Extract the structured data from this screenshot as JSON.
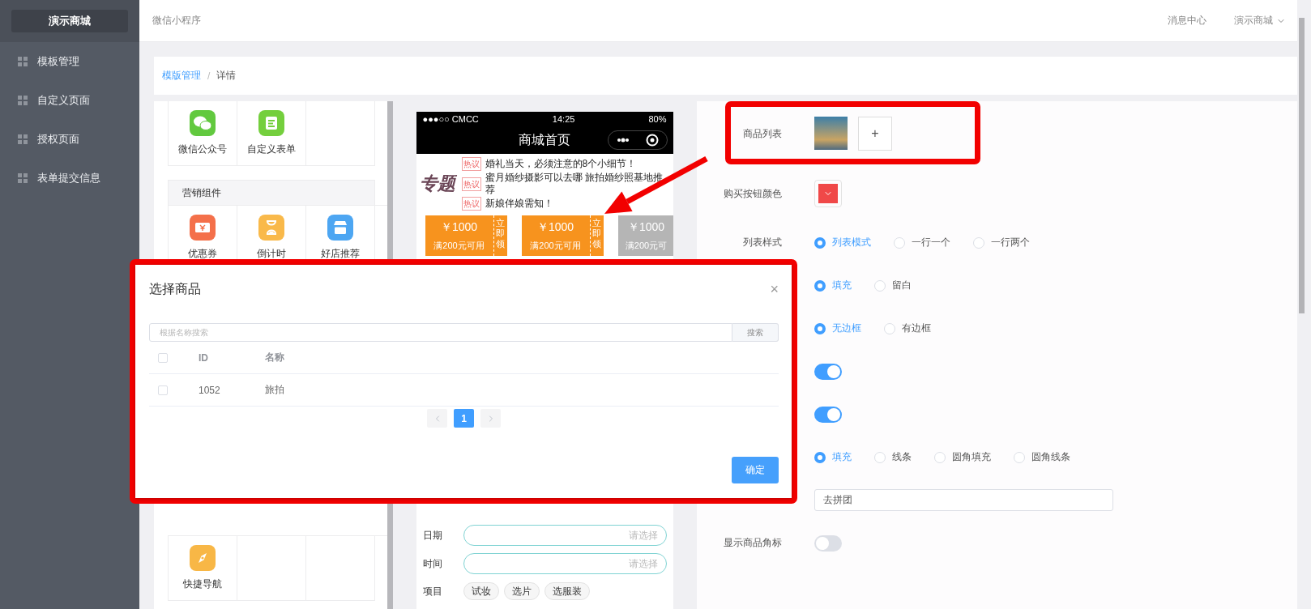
{
  "sidebar": {
    "brand": "演示商城",
    "items": [
      {
        "label": "模板管理"
      },
      {
        "label": "自定义页面"
      },
      {
        "label": "授权页面"
      },
      {
        "label": "表单提交信息"
      }
    ]
  },
  "header": {
    "title": "微信小程序",
    "link": "消息中心",
    "account": "演示商城"
  },
  "breadcrumb": {
    "items": [
      "模版管理",
      "详情"
    ],
    "separator": "/"
  },
  "components": {
    "top": [
      {
        "label": "微信公众号",
        "kind": "chat"
      },
      {
        "label": "自定义表单",
        "kind": "form"
      }
    ],
    "marketing": {
      "title": "营销组件",
      "items": [
        {
          "label": "优惠券",
          "kind": "ticket"
        },
        {
          "label": "倒计时",
          "kind": "hourglass"
        },
        {
          "label": "好店推荐",
          "kind": "shop"
        }
      ]
    },
    "bottom": [
      {
        "label": "快捷导航",
        "kind": "compass"
      }
    ]
  },
  "phone": {
    "status": {
      "carrier": "●●●○○ CMCC",
      "time": "14:25",
      "battery": "80%"
    },
    "title": "商城首页",
    "topic": {
      "badge": "专题",
      "items": [
        {
          "tag": "热议",
          "text": "婚礼当天，必须注意的8个小细节！"
        },
        {
          "tag": "热议",
          "text": "蜜月婚纱摄影可以去哪 旅拍婚纱照基地推荐"
        },
        {
          "tag": "热议",
          "text": "新娘伴娘需知！"
        }
      ]
    },
    "coupons": [
      {
        "amount": "￥1000",
        "condition": "满200元可用",
        "action": "立即领",
        "available": true
      },
      {
        "amount": "￥1000",
        "condition": "满200元可用",
        "action": "立即领",
        "available": true
      },
      {
        "amount": "￥1000",
        "condition": "满200元可",
        "available": false
      }
    ],
    "form": [
      {
        "kind": "field",
        "label": "日期",
        "placeholder": "请选择"
      },
      {
        "kind": "field",
        "label": "时间",
        "placeholder": "请选择"
      },
      {
        "kind": "chips",
        "label": "项目",
        "options": [
          "试妆",
          "选片",
          "选服装"
        ]
      }
    ]
  },
  "settings": [
    {
      "kind": "goods",
      "label": "商品列表",
      "add": "+"
    },
    {
      "kind": "color",
      "label": "购买按钮颜色",
      "color": "#f04848"
    },
    {
      "kind": "radio",
      "label": "列表样式",
      "options": [
        {
          "label": "列表模式",
          "selected": true
        },
        {
          "label": "一行一个",
          "selected": false
        },
        {
          "label": "一行两个",
          "selected": false
        }
      ]
    },
    {
      "kind": "radio",
      "options": [
        {
          "label": "填充",
          "selected": true
        },
        {
          "label": "留白",
          "selected": false
        }
      ]
    },
    {
      "kind": "radio",
      "options": [
        {
          "label": "无边框",
          "selected": true
        },
        {
          "label": "有边框",
          "selected": false
        }
      ]
    },
    {
      "kind": "switch",
      "on": true
    },
    {
      "kind": "switch",
      "on": true
    },
    {
      "kind": "radio",
      "options": [
        {
          "label": "填充",
          "selected": true
        },
        {
          "label": "线条",
          "selected": false
        },
        {
          "label": "圆角填充",
          "selected": false
        },
        {
          "label": "圆角线条",
          "selected": false
        }
      ]
    },
    {
      "kind": "input",
      "value": "去拼团"
    },
    {
      "kind": "switch",
      "label": "显示商品角标",
      "on": false
    }
  ],
  "modal": {
    "title": "选择商品",
    "close": "×",
    "search": {
      "placeholder": "根据名称搜索",
      "button": "搜索"
    },
    "header_checked": false,
    "columns": [
      "ID",
      "名称"
    ],
    "rows": [
      {
        "checked": false,
        "cells": [
          "1052",
          "旅拍"
        ]
      }
    ],
    "pagination": {
      "pages": [
        {
          "label": "1",
          "selected": true
        }
      ]
    },
    "confirm": "确定"
  }
}
